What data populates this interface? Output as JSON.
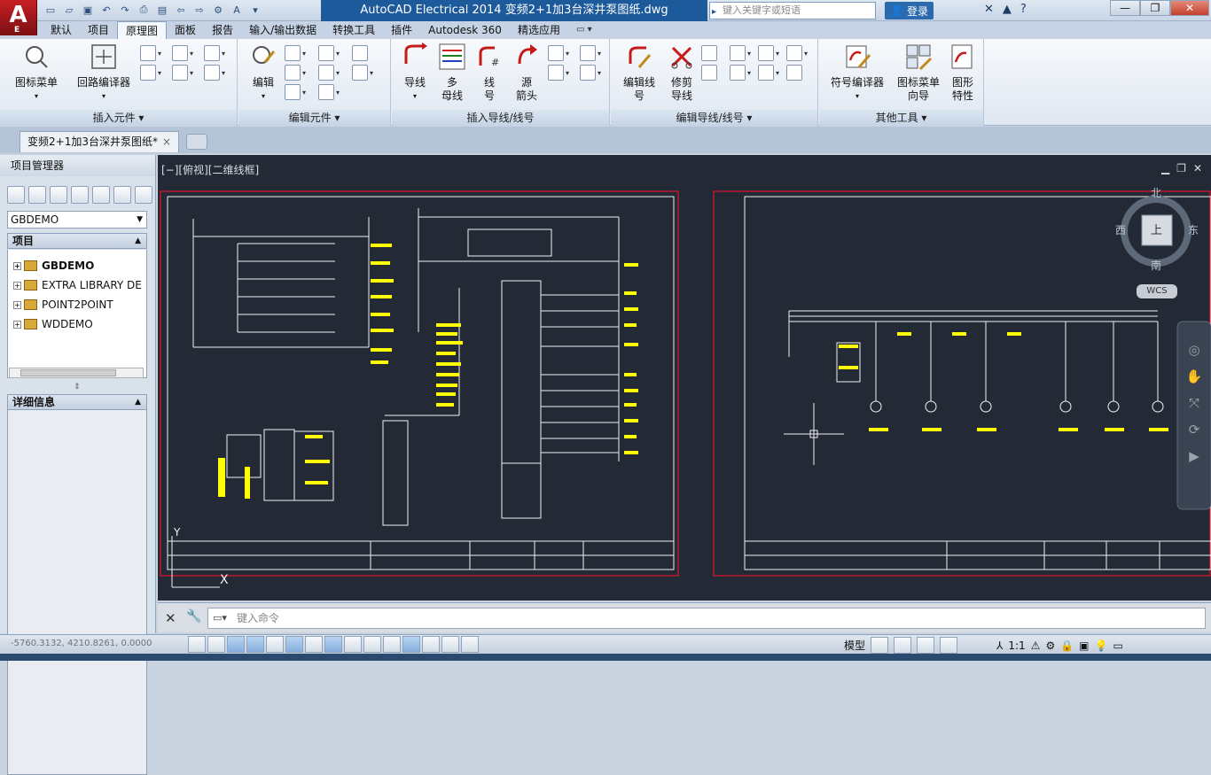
{
  "title": {
    "center": "AutoCAD Electrical 2014    变频2+1加3台深井泵图纸.dwg",
    "search_placeholder": "键入关键字或短语",
    "login": "登录",
    "logo_letter": "A",
    "logo_sub": "E"
  },
  "menu_tabs": [
    "默认",
    "项目",
    "原理图",
    "面板",
    "报告",
    "输入/输出数据",
    "转换工具",
    "插件",
    "Autodesk 360",
    "精选应用"
  ],
  "ribbon": {
    "panels": {
      "insert_components": "插入元件 ▾",
      "edit_components": "编辑元件 ▾",
      "insert_wires": "插入导线/线号",
      "edit_wires": "编辑导线/线号 ▾",
      "other_tools": "其他工具 ▾"
    },
    "buttons": {
      "icon_menu": "图标菜单",
      "circuit_builder": "回路编译器",
      "edit": "编辑",
      "wire": "导线",
      "multi_bus": "多\n母线",
      "wire_number": "线\n号",
      "source_arrow": "源\n箭头",
      "edit_wire_number": "编辑线\n号",
      "trim_wire": "修剪\n导线",
      "symbol_builder": "符号编译器",
      "icon_menu_wizard": "图标菜单\n向导",
      "graphic_props": "图形\n特性"
    }
  },
  "doc_tab": {
    "label": "变频2+1加3台深井泵图纸*",
    "close": "×"
  },
  "project_manager": {
    "title": "项目管理器",
    "current_project": "GBDEMO",
    "projects_header": "项目",
    "projects": [
      "GBDEMO",
      "EXTRA LIBRARY DE",
      "POINT2POINT",
      "WDDEMO"
    ],
    "details_header": "详细信息"
  },
  "viewport": {
    "label": "[−][俯视][二维线框]",
    "viewcube": {
      "north": "北",
      "south": "南",
      "east": "东",
      "west": "西",
      "top": "上",
      "wcs": "WCS"
    }
  },
  "command": {
    "placeholder": "键入命令"
  },
  "status": {
    "coords": "-5760.3132, 4210.8261, 0.0000",
    "model": "模型",
    "scale": "1:1"
  },
  "colors": {
    "canvas": "#232a36",
    "border_red": "#e0142a",
    "drawing_yellow": "#ffff00",
    "drawing_white": "#f2f2f2",
    "magenta": "#ff00ff",
    "title_blue": "#1d5a9c"
  }
}
